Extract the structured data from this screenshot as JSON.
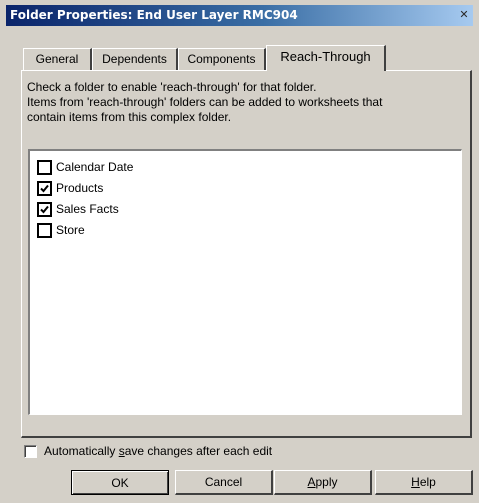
{
  "window": {
    "title": "Folder Properties: End User Layer  RMC904",
    "close_glyph": "✕"
  },
  "tabs": [
    {
      "label": "General"
    },
    {
      "label": "Dependents"
    },
    {
      "label": "Components"
    },
    {
      "label": "Reach-Through",
      "active": true
    }
  ],
  "description": {
    "line1": "Check a folder to enable 'reach-through' for that folder.",
    "line2": "Items from 'reach-through' folders can be added to worksheets that",
    "line3": "contain items from this complex folder."
  },
  "folders": [
    {
      "label": "Calendar Date",
      "checked": false
    },
    {
      "label": "Products",
      "checked": true
    },
    {
      "label": "Sales Facts",
      "checked": true
    },
    {
      "label": "Store",
      "checked": false
    }
  ],
  "auto_save": {
    "label_pre": "Automatically ",
    "label_accel": "s",
    "label_post": "ave changes after each edit",
    "checked": false
  },
  "buttons": {
    "ok": "OK",
    "cancel": "Cancel",
    "apply_accel": "A",
    "apply_rest": "pply",
    "help_accel": "H",
    "help_rest": "elp"
  }
}
